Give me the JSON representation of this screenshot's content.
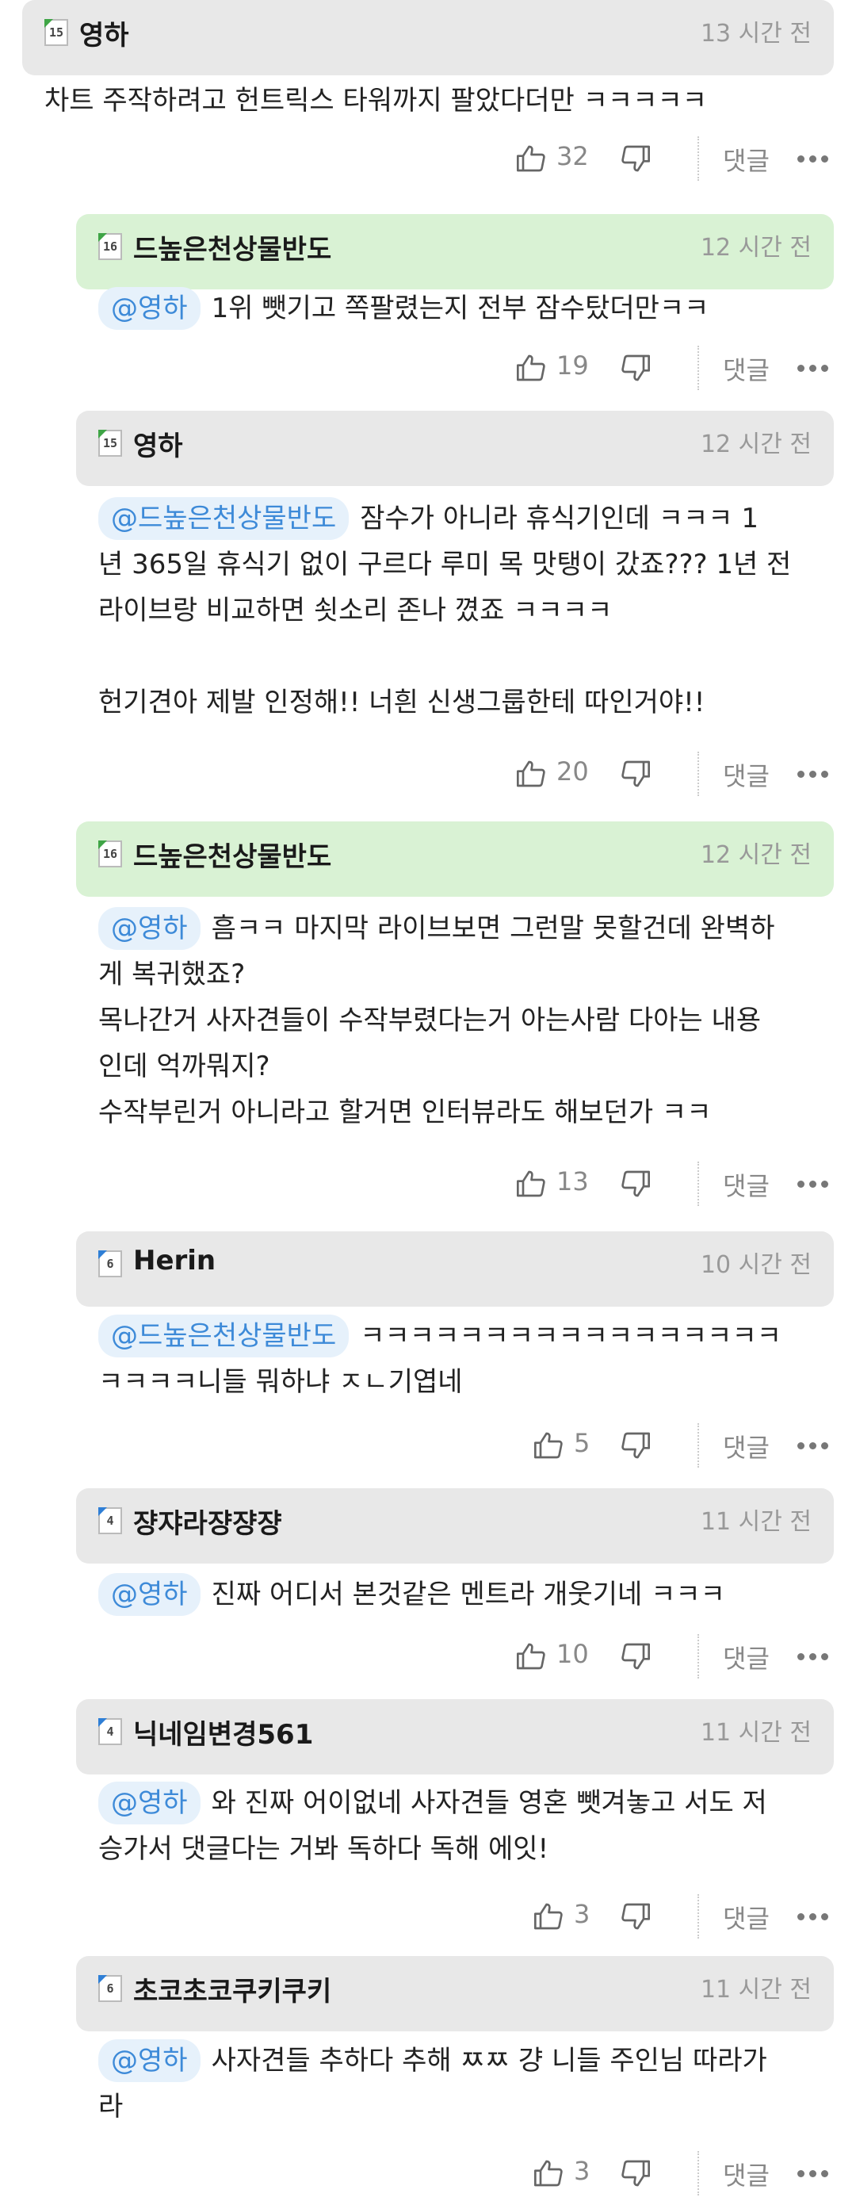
{
  "reply_label": "댓글",
  "comments": [
    {
      "level": "15",
      "nickname": "영하",
      "time": "13 시간 전",
      "mention": "",
      "lines": [
        "차트 주작하려고 헌트릭스 타워까지 팔았다더만 ㅋㅋㅋㅋㅋ"
      ],
      "likes": "32"
    },
    {
      "level": "16",
      "nickname": "드높은천상물반도",
      "time": "12 시간 전",
      "mention": "@영하",
      "lines": [
        "1위 뺏기고 쪽팔렸는지 전부 잠수탔더만ㅋㅋ"
      ],
      "likes": "19"
    },
    {
      "level": "15",
      "nickname": "영하",
      "time": "12 시간 전",
      "mention": "@드높은천상물반도",
      "lines": [
        "잠수가 아니라 휴식기인데 ㅋㅋㅋ 1",
        "년 365일 휴식기 없이 구르다 루미 목 맛탱이 갔죠??? 1년 전",
        "라이브랑 비교하면 쇳소리 존나 꼈죠 ㅋㅋㅋㅋ",
        "",
        "헌기견아 제발 인정해!! 너흰 신생그룹한테 따인거야!!"
      ],
      "likes": "20"
    },
    {
      "level": "16",
      "nickname": "드높은천상물반도",
      "time": "12 시간 전",
      "mention": "@영하",
      "lines": [
        "흠ㅋㅋ 마지막 라이브보면 그런말 못할건데 완벽하",
        "게 복귀했죠?",
        "목나간거 사자견들이 수작부렸다는거 아는사람 다아는 내용",
        "인데 억까뭐지?",
        "수작부린거 아니라고 할거면 인터뷰라도 해보던가 ㅋㅋ"
      ],
      "likes": "13"
    },
    {
      "level": "6",
      "nickname": "Herin",
      "time": "10 시간 전",
      "mention": "@드높은천상물반도",
      "lines": [
        "ㅋㅋㅋㅋㅋㅋㅋㅋㅋㅋㅋㅋㅋㅋㅋㅋㅋ",
        "ㅋㅋㅋㅋ니들 뭐하냐 ㅈㄴ기엽네"
      ],
      "likes": "5"
    },
    {
      "level": "4",
      "nickname": "쟝쟈라쟝쟝쟝",
      "time": "11 시간 전",
      "mention": "@영하",
      "lines": [
        "진짜 어디서 본것같은 멘트라 개웃기네 ㅋㅋㅋ"
      ],
      "likes": "10"
    },
    {
      "level": "4",
      "nickname": "닉네임변경561",
      "time": "11 시간 전",
      "mention": "@영하",
      "lines": [
        "와 진짜 어이없네 사자견들 영혼 뺏겨놓고 서도 저",
        "승가서 댓글다는 거봐 독하다 독해 에잇!"
      ],
      "likes": "3"
    },
    {
      "level": "6",
      "nickname": "초코초코쿠키쿠키",
      "time": "11 시간 전",
      "mention": "@영하",
      "lines": [
        "사자견들 추하다 추해 ㅉㅉ 걍 니들 주인님 따라가",
        "라"
      ],
      "likes": "3"
    }
  ],
  "colors": {
    "header_gray": "#e8e8e8",
    "header_green": "#d9f2d4",
    "mention_bg": "#e6f1fb",
    "mention_text": "#3d8ad8",
    "muted": "#999999"
  }
}
